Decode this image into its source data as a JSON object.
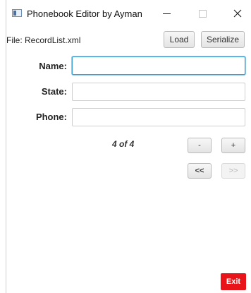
{
  "window": {
    "title": "Phonebook Editor by Ayman"
  },
  "toolbar": {
    "file_label": "File: RecordList.xml",
    "load_label": "Load",
    "serialize_label": "Serialize"
  },
  "form": {
    "name_label": "Name:",
    "name_value": "",
    "state_label": "State:",
    "state_value": "",
    "phone_label": "Phone:",
    "phone_value": ""
  },
  "navigation": {
    "counter": "4 of 4",
    "minus_label": "-",
    "plus_label": "+",
    "first_label": "<<",
    "last_label": ">>"
  },
  "footer": {
    "exit_label": "Exit"
  },
  "colors": {
    "exit": "#e8141a",
    "focus": "#39a0d8"
  }
}
